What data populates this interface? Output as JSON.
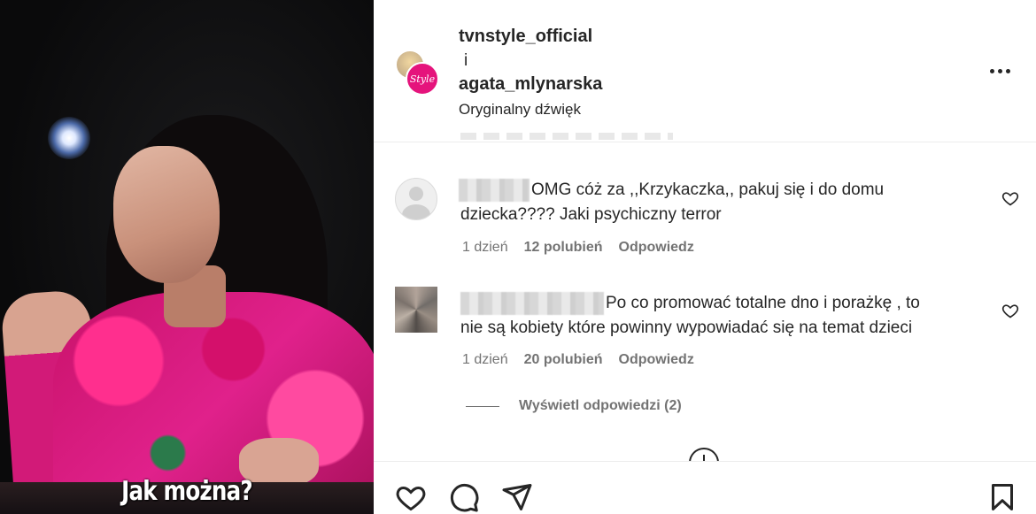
{
  "video": {
    "caption": "Jak można?"
  },
  "header": {
    "user1": "tvnstyle_official",
    "connector": "i",
    "user2": "agata_mlynarska",
    "audio": "Oryginalny dźwięk",
    "avatar_badge": "Style"
  },
  "comments": [
    {
      "text_line1": "OMG cóż za ,,Krzykaczka,, pakuj się i do domu",
      "text_line2": "dziecka???? Jaki psychiczny terror",
      "time": "1 dzień",
      "likes": "12 polubień",
      "reply": "Odpowiedz"
    },
    {
      "text_line1": "Po co promować totalne dno i porażkę , to",
      "text_line2": "nie są kobiety które powinny wypowiadać się na temat dzieci",
      "time": "1 dzień",
      "likes": "20 polubień",
      "reply": "Odpowiedz"
    }
  ],
  "view_replies": "Wyświetl odpowiedzi (2)",
  "icons": [
    "more-options-icon",
    "heart-icon",
    "comment-icon",
    "share-icon",
    "bookmark-icon",
    "load-more-icon"
  ]
}
